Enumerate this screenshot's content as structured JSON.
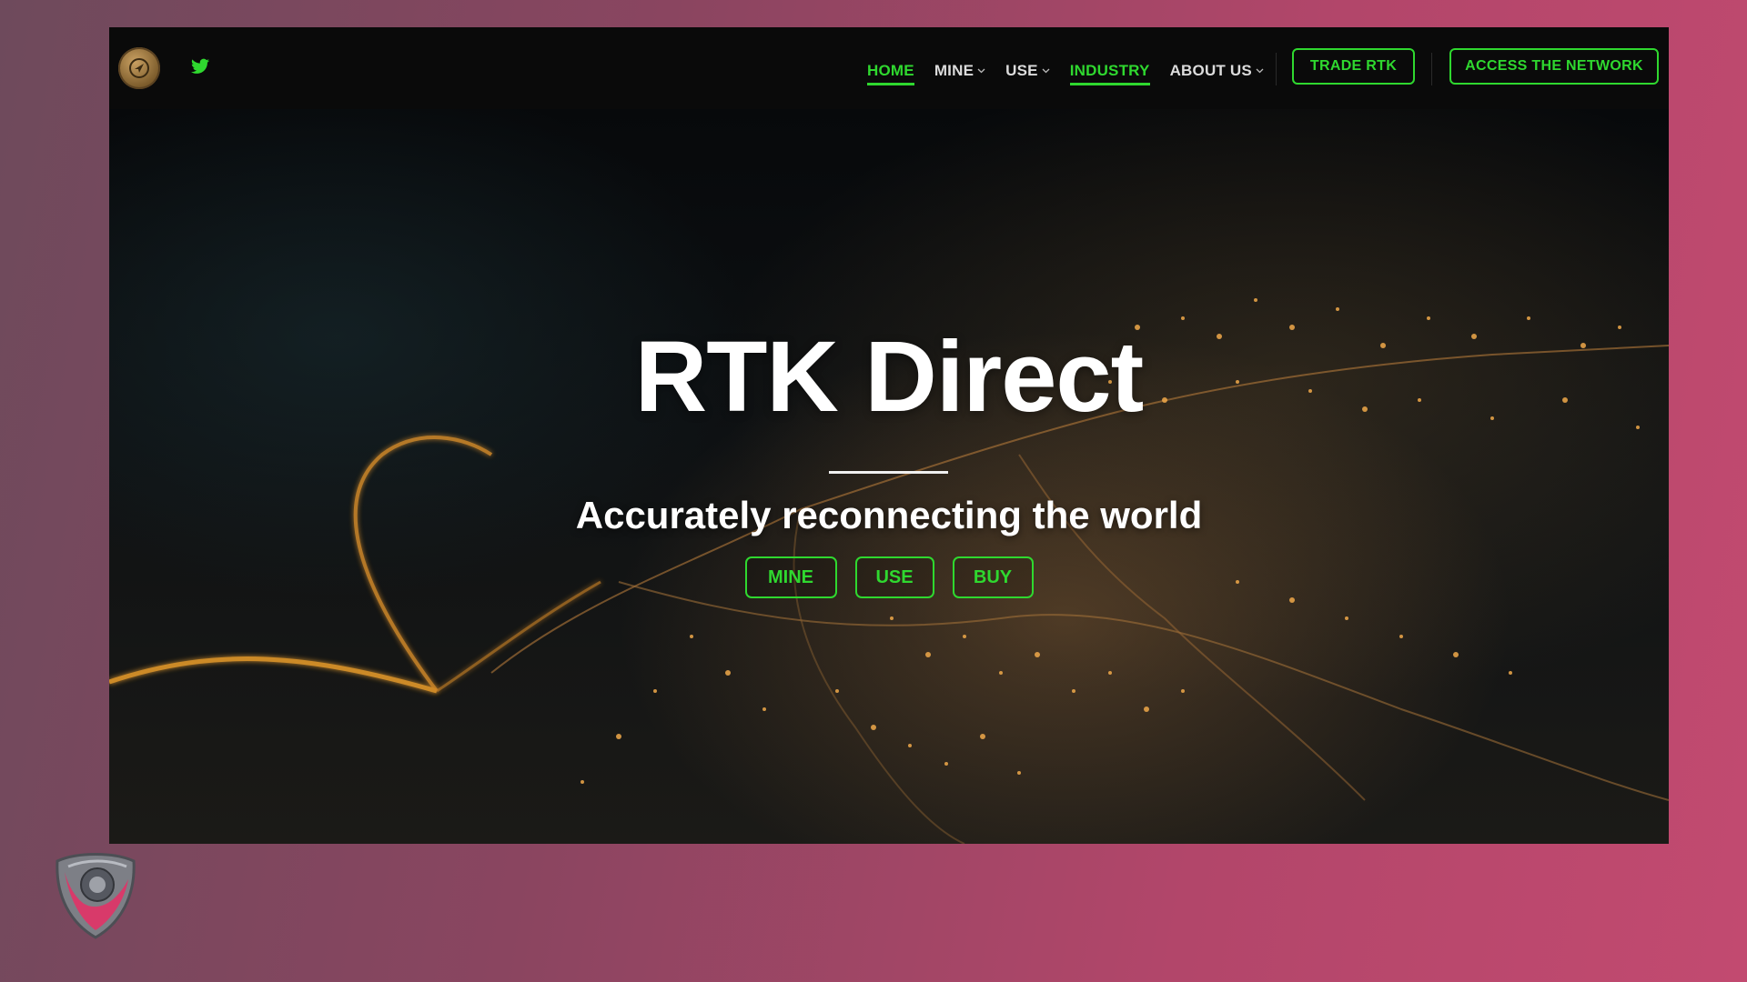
{
  "nav": {
    "links": [
      {
        "label": "HOME",
        "active": true,
        "dropdown": false
      },
      {
        "label": "MINE",
        "active": false,
        "dropdown": true
      },
      {
        "label": "USE",
        "active": false,
        "dropdown": true
      },
      {
        "label": "INDUSTRY",
        "active": true,
        "dropdown": false
      },
      {
        "label": "ABOUT US",
        "active": false,
        "dropdown": true
      }
    ],
    "trade_button": "TRADE RTK",
    "access_button": "ACCESS THE NETWORK"
  },
  "hero": {
    "title": "RTK Direct",
    "subtitle": "Accurately reconnecting the world",
    "buttons": [
      "MINE",
      "USE",
      "BUY"
    ]
  },
  "icons": {
    "logo": "rtk-coin-logo",
    "social": "twitter-icon",
    "overlay": "shield-logo-icon"
  },
  "colors": {
    "accent": "#2fd82f",
    "nav_bg": "#0a0a0a",
    "text": "#ffffff"
  }
}
